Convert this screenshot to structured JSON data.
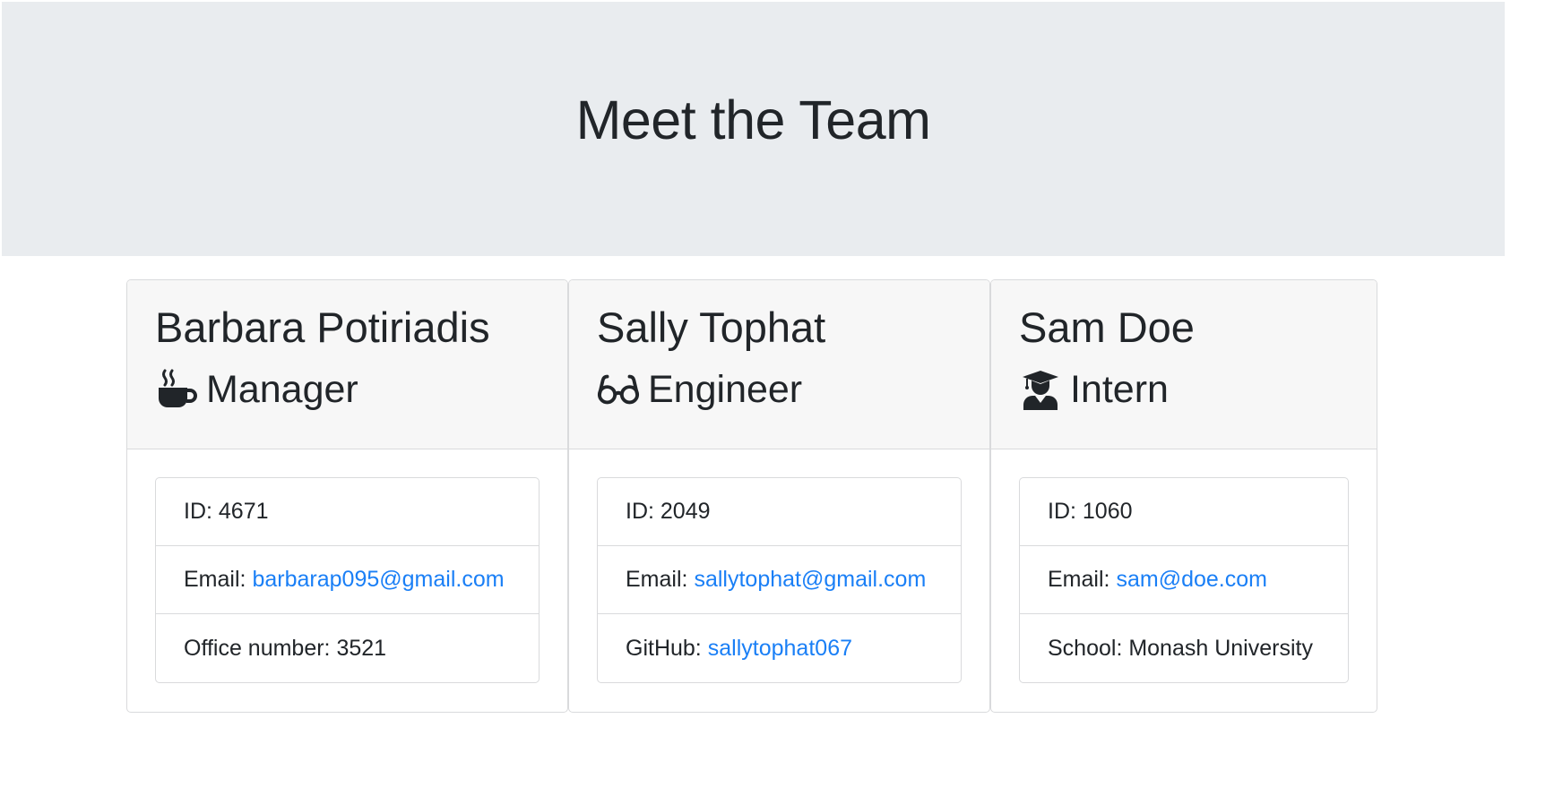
{
  "header": {
    "title": "Meet the Team"
  },
  "team": [
    {
      "name": "Barbara Potiriadis",
      "role": "Manager",
      "role_icon": "coffee-mug-icon",
      "id_label": "ID: 4671",
      "email_label": "Email:",
      "email": "barbarap095@gmail.com",
      "extra_text": "Office number: 3521"
    },
    {
      "name": "Sally Tophat",
      "role": "Engineer",
      "role_icon": "glasses-icon",
      "id_label": "ID: 2049",
      "email_label": "Email:",
      "email": "sallytophat@gmail.com",
      "extra_label": "GitHub:",
      "extra_link": "sallytophat067"
    },
    {
      "name": "Sam Doe",
      "role": "Intern",
      "role_icon": "graduate-icon",
      "id_label": "ID: 1060",
      "email_label": "Email:",
      "email": "sam@doe.com",
      "extra_text": "School: Monash University"
    }
  ],
  "colors": {
    "jumbotron_bg": "#e9ecef",
    "link": "#1a7ff6",
    "card_header_bg": "#f7f7f7"
  }
}
